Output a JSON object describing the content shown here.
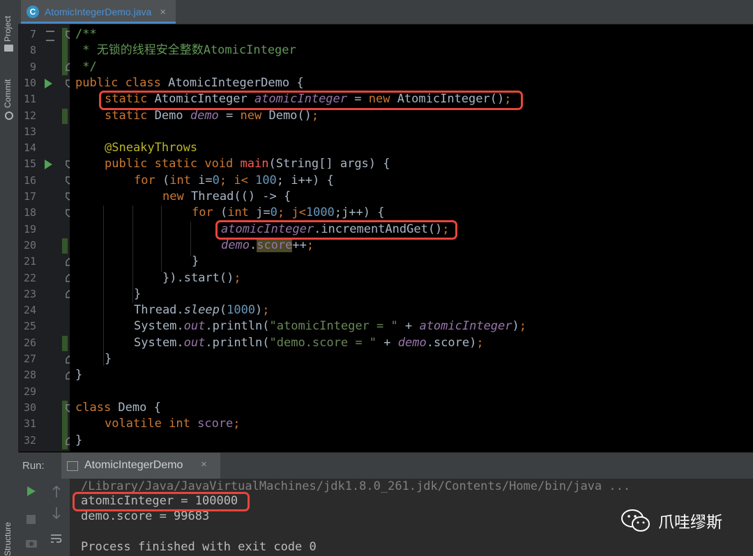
{
  "tool_strip": {
    "project_label": "Project",
    "commit_label": "Commit",
    "structure_label": "Structure"
  },
  "editor_tab": {
    "label": "AtomicIntegerDemo.java",
    "icon": "class-c-icon",
    "close": "×"
  },
  "line_numbers": [
    "7",
    "8",
    "9",
    "10",
    "11",
    "12",
    "13",
    "14",
    "15",
    "16",
    "17",
    "18",
    "19",
    "20",
    "21",
    "22",
    "23",
    "24",
    "25",
    "26",
    "27",
    "28",
    "29",
    "30",
    "31",
    "32"
  ],
  "code": {
    "l7": {
      "a": "/**"
    },
    "l8": {
      "a": " * 无锁的线程安全整数AtomicInteger"
    },
    "l9": {
      "a": " */"
    },
    "l10": {
      "kw1": "public",
      "kw2": "class",
      "cls": "AtomicIntegerDemo",
      "rest": " {"
    },
    "l11": {
      "kw": "static",
      "type": " AtomicInteger ",
      "field": "atomicInteger",
      "eq": " = ",
      "nw": "new",
      "ctor": " AtomicInteger()",
      "semi": ";"
    },
    "l12": {
      "kw": "static",
      "type": " Demo ",
      "field": "demo",
      "eq": " = ",
      "nw": "new",
      "ctor": " Demo()",
      "semi": ";"
    },
    "l14": {
      "ann": "@SneakyThrows"
    },
    "l15": {
      "kw1": "public",
      "kw2": "static",
      "kw3": "void",
      "meth": "main",
      "rest": "(String[] args) {"
    },
    "l16": {
      "kw": "for",
      "p1": " (",
      "kw2": "int",
      "p2": " i=",
      "n1": "0",
      "p3": "; i< ",
      "n2": "100",
      "p4": "; i++) {"
    },
    "l17": {
      "nw": "new",
      "rest": " Thread(() -> {"
    },
    "l18": {
      "kw": "for",
      "p1": " (",
      "kw2": "int",
      "p2": " j=",
      "n1": "0",
      "p3": "; j<",
      "n2": "1000",
      "p4": ";j++) {"
    },
    "l19": {
      "field": "atomicInteger",
      "rest": ".incrementAndGet()",
      "semi": ";"
    },
    "l20": {
      "field": "demo",
      "dot": ".",
      "fld": "score",
      "rest": "++",
      "semi": ";"
    },
    "l21": {
      "a": "}"
    },
    "l22": {
      "a": "}).start()",
      "semi": ";"
    },
    "l23": {
      "a": "}"
    },
    "l24": {
      "a": "Thread.",
      "sl": "sleep",
      "p": "(",
      "n": "1000",
      "c": ")",
      "semi": ";"
    },
    "l25": {
      "a": "System.",
      "out": "out",
      "b": ".println(",
      "s": "\"atomicInteger = \"",
      "c": " + ",
      "f": "atomicInteger",
      "d": ")",
      "semi": ";"
    },
    "l26": {
      "a": "System.",
      "out": "out",
      "b": ".println(",
      "s": "\"demo.score = \"",
      "c": " + ",
      "f": "demo",
      "g": ".score)",
      "semi": ";"
    },
    "l27": {
      "a": "}"
    },
    "l28": {
      "a": "}"
    },
    "l30": {
      "kw": "class",
      "rest": " Demo {"
    },
    "l31": {
      "kw1": "volatile",
      "kw2": "int",
      "fld": "score",
      "semi": ";"
    },
    "l32": {
      "a": "}"
    }
  },
  "run_panel": {
    "title": "Run:",
    "tab_label": "AtomicIntegerDemo",
    "close": "×",
    "console": [
      "/Library/Java/JavaVirtualMachines/jdk1.8.0_261.jdk/Contents/Home/bin/java ...",
      "atomicInteger = 100000",
      "demo.score = 99683",
      "",
      "Process finished with exit code 0"
    ]
  },
  "watermark": {
    "text": "爪哇缪斯",
    "icon": "wechat-icon"
  },
  "colors": {
    "highlight_box": "#e8453c",
    "keyword": "#cc7832",
    "field": "#9876aa",
    "string": "#6a8759",
    "number": "#6897bb",
    "comment": "#629755"
  }
}
